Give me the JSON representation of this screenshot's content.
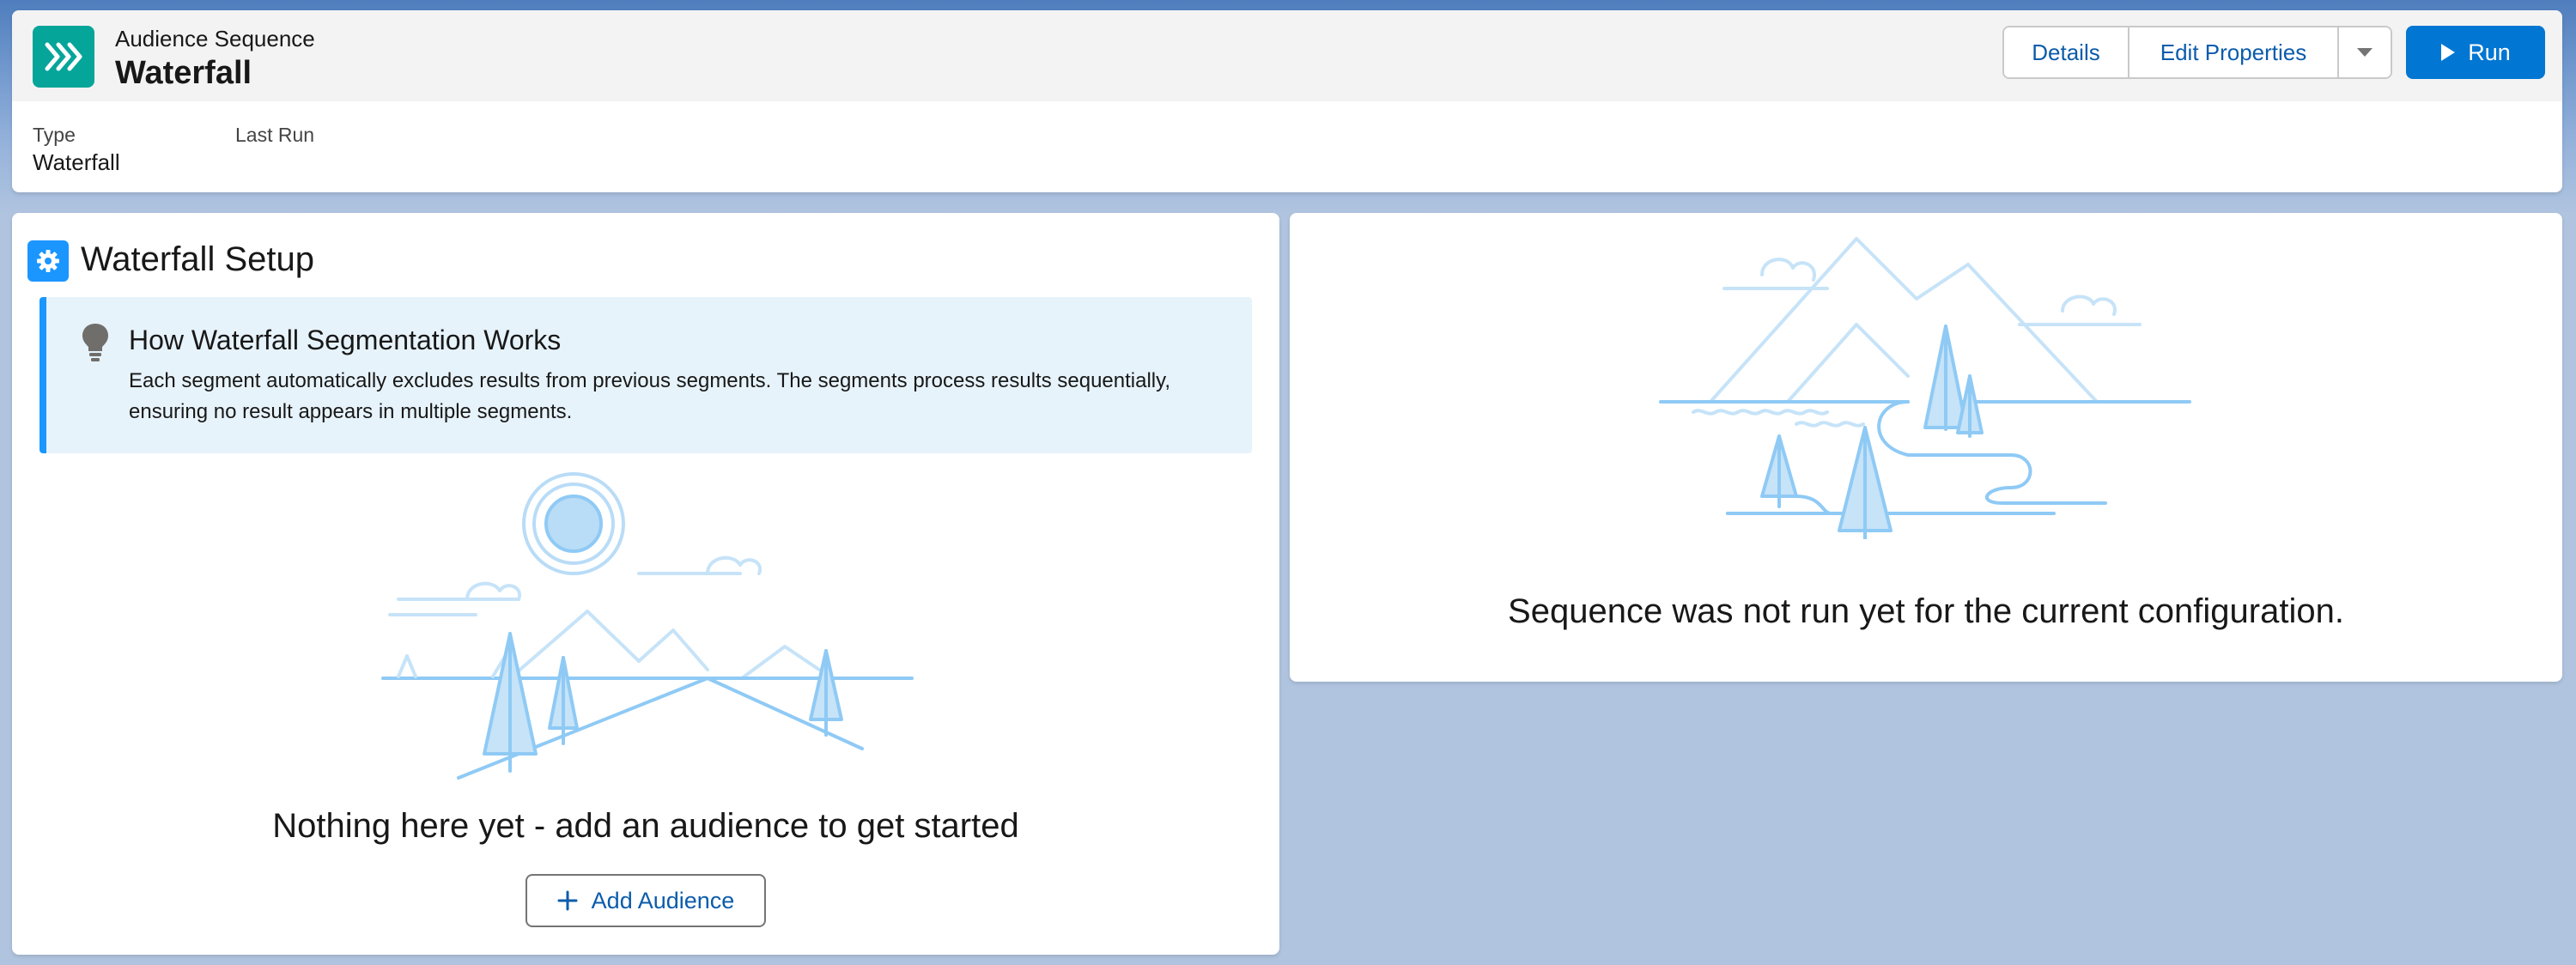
{
  "header": {
    "object_type": "Audience Sequence",
    "title": "Waterfall",
    "actions": {
      "details": "Details",
      "edit_properties": "Edit Properties",
      "run": "Run"
    },
    "fields": [
      {
        "label": "Type",
        "value": "Waterfall"
      },
      {
        "label": "Last Run",
        "value": ""
      }
    ]
  },
  "setup": {
    "title": "Waterfall Setup",
    "info": {
      "title": "How Waterfall Segmentation Works",
      "text": "Each segment automatically excludes results from previous segments. The segments process results sequentially, ensuring no result appears in multiple segments."
    },
    "empty_message": "Nothing here yet - add an audience to get started",
    "add_button": "Add Audience"
  },
  "results": {
    "empty_message": "Sequence was not run yet for the current configuration."
  },
  "icons": {
    "object": "chevrons-right-icon",
    "setup": "gear-icon",
    "info": "lightbulb-icon",
    "menu": "chevron-down-icon",
    "run": "play-icon",
    "add": "plus-icon"
  },
  "colors": {
    "brand_blue": "#0176d3",
    "link_blue": "#0b5cab",
    "teal": "#06a59a",
    "info_bg": "#e7f3fb",
    "illustration": "#8fcaf5",
    "page_bg": "#b0c4df"
  }
}
